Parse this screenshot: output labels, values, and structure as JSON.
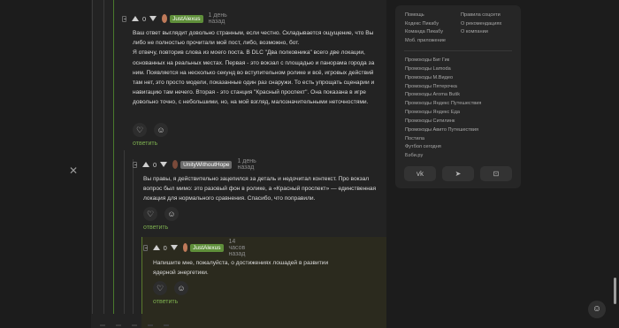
{
  "colors": {
    "accent_green": "#7cae4f",
    "author_green": "#5f8f3a",
    "highlight": "#2b2a1e"
  },
  "comments": [
    {
      "score": "0",
      "author": "JustAlexus",
      "time": "1 день назад",
      "body": "Ваш ответ выглядит довольно странным, если честно. Складывается ощущение, что Вы либо не полностью прочитали мой пост, либо, возможно, бот.\nЯ отвечу, повторив слова из моего поста. В DLC \"Два полковника\" всего две локации, основанных на реальных местах. Первая - это вокзал с площадью и панорама города за ним. Появляется на несколько секунд во вступительном ролике и всё, игровых действий там нет, это просто модели, показанные один раз снаружи. То есть упрощать сценарии и навигацию там нечего. Вторая - это станция \"Красный проспект\". Она показана в игре довольно точно, с небольшими, но, на мой взгляд, малозначительными неточностями.",
      "reply": "ответить",
      "like_icon": "heart-icon",
      "react_icon": "emoji-icon"
    },
    {
      "score": "0",
      "author": "UnityWithoutHope",
      "time": "1 день назад",
      "body": "Вы правы, я действительно зацепился за деталь и недочитал контекст. Про вокзал вопрос был мимо: это разовый фон в ролике, а «Красный проспект» — единственная локация для нормального сравнения. Спасибо, что поправили.",
      "reply": "ответить",
      "like_icon": "heart-icon",
      "react_icon": "emoji-icon"
    },
    {
      "score": "0",
      "author": "JustAlexus",
      "time": "14 часов назад",
      "body": "Напишите мне, пожалуйста, о достижениях лошадей в развитии ядерной энергетики.",
      "reply": "ответить",
      "like_icon": "heart-icon",
      "react_icon": "emoji-icon"
    }
  ],
  "sidebar": {
    "links_left": [
      "Помощь",
      "Кодекс Пикабу",
      "Команда Пикабу",
      "Моб. приложение"
    ],
    "links_right": [
      "Правила соцсети",
      "О рекомендациях",
      "О компании"
    ],
    "promo_links": [
      "Промокоды Биг Гик",
      "Промокоды Lamoda",
      "Промокоды М.Видео",
      "Промокоды Пятерочка",
      "Промокоды Aroma Butik",
      "Промокоды Яндекс Путешествия",
      "Промокоды Яндекс Еда",
      "Промокоды Ситилинк",
      "Промокоды Авито Путешествия",
      "Постила",
      "Футбол сегодня",
      "Бэби.ру"
    ],
    "social": [
      {
        "name": "vk",
        "glyph": "vk"
      },
      {
        "name": "telegram",
        "glyph": "➤"
      },
      {
        "name": "odnoklassniki",
        "glyph": "⊡"
      }
    ]
  },
  "collapse_glyph": "✕",
  "fab_glyph": "☺"
}
